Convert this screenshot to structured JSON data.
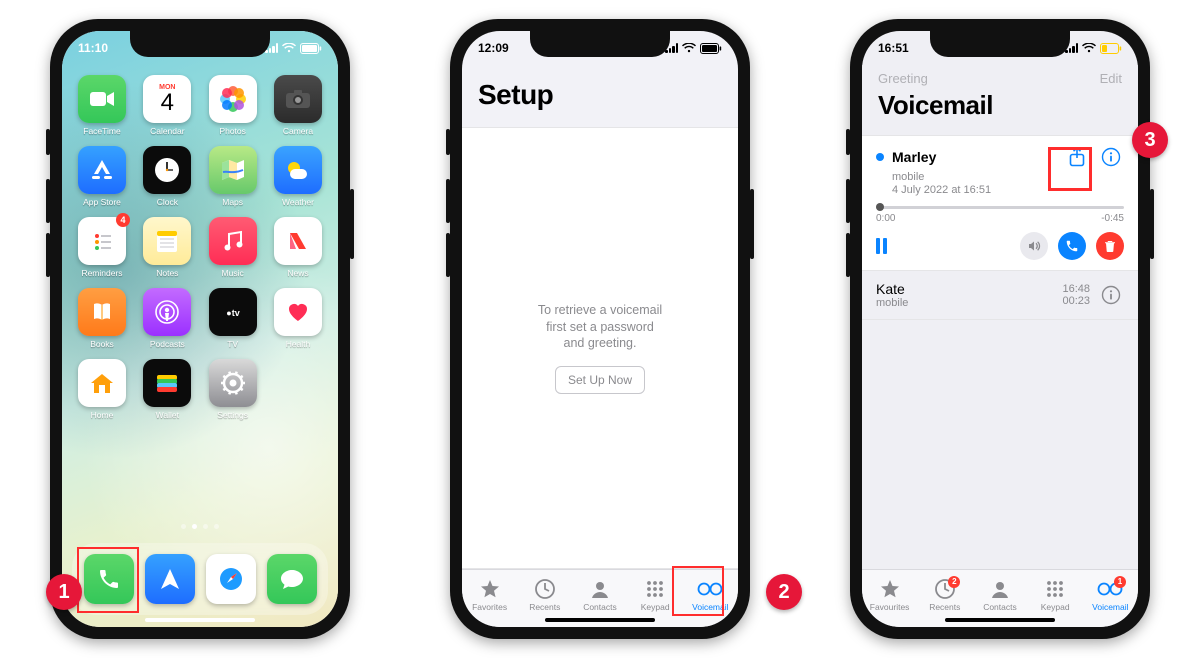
{
  "callouts": [
    "1",
    "2",
    "3"
  ],
  "phone1": {
    "time": "11:10",
    "calendar_day": "MON",
    "calendar_date": "4",
    "apps": {
      "r1": [
        {
          "label": "FaceTime",
          "name": "facetime",
          "bg": "linear-gradient(#5bd769,#34c759)",
          "glyph": "video"
        },
        {
          "label": "Calendar",
          "name": "calendar",
          "bg": "#fff",
          "glyph": "cal"
        },
        {
          "label": "Photos",
          "name": "photos",
          "bg": "#fff",
          "glyph": "photos"
        },
        {
          "label": "Camera",
          "name": "camera",
          "bg": "linear-gradient(#4a4a4a,#2b2b2b)",
          "glyph": "camera"
        }
      ],
      "r2": [
        {
          "label": "App Store",
          "name": "appstore",
          "bg": "linear-gradient(#35a1ff,#1e6dff)",
          "glyph": "appstore"
        },
        {
          "label": "Clock",
          "name": "clock",
          "bg": "#0b0b0b",
          "glyph": "clock"
        },
        {
          "label": "Maps",
          "name": "maps",
          "bg": "linear-gradient(#b8e986,#67c96b)",
          "glyph": "maps"
        },
        {
          "label": "Weather",
          "name": "weather",
          "bg": "linear-gradient(#3aa3ff,#1e6dff)",
          "glyph": "weather"
        }
      ],
      "r3": [
        {
          "label": "Reminders",
          "name": "reminders",
          "bg": "#fff",
          "glyph": "reminders",
          "badge": "4"
        },
        {
          "label": "Notes",
          "name": "notes",
          "bg": "linear-gradient(#fff7cc,#ffeb99)",
          "glyph": "notes"
        },
        {
          "label": "Music",
          "name": "music",
          "bg": "linear-gradient(#ff5b73,#ff2d55)",
          "glyph": "music"
        },
        {
          "label": "News",
          "name": "news",
          "bg": "#fff",
          "glyph": "news"
        }
      ],
      "r4": [
        {
          "label": "Books",
          "name": "books",
          "bg": "linear-gradient(#ff9e42,#ff7a1a)",
          "glyph": "books"
        },
        {
          "label": "Podcasts",
          "name": "podcasts",
          "bg": "linear-gradient(#c36bff,#9b30ff)",
          "glyph": "podcasts"
        },
        {
          "label": "TV",
          "name": "tv",
          "bg": "#0b0b0b",
          "glyph": "tv"
        },
        {
          "label": "Health",
          "name": "health",
          "bg": "#fff",
          "glyph": "health"
        }
      ],
      "r5": [
        {
          "label": "Home",
          "name": "home",
          "bg": "#fff",
          "glyph": "home"
        },
        {
          "label": "Wallet",
          "name": "wallet",
          "bg": "#0b0b0b",
          "glyph": "wallet"
        },
        {
          "label": "Settings",
          "name": "settings",
          "bg": "linear-gradient(#d9d9d9,#8e8e93)",
          "glyph": "gear"
        }
      ]
    },
    "dock": [
      {
        "name": "phone",
        "bg": "linear-gradient(#5bd769,#34c759)",
        "glyph": "phone"
      },
      {
        "name": "arrow",
        "bg": "linear-gradient(#35a1ff,#1e6dff)",
        "glyph": "nav"
      },
      {
        "name": "safari",
        "bg": "#fff",
        "glyph": "safari"
      },
      {
        "name": "messages",
        "bg": "linear-gradient(#5bd769,#34c759)",
        "glyph": "msg"
      }
    ]
  },
  "phone2": {
    "time": "12:09",
    "title": "Setup",
    "body_line1": "To retrieve a voicemail",
    "body_line2": "first set a password",
    "body_line3": "and greeting.",
    "button": "Set Up Now",
    "tabs": [
      {
        "name": "favorites",
        "label": "Favorites"
      },
      {
        "name": "recents",
        "label": "Recents"
      },
      {
        "name": "contacts",
        "label": "Contacts"
      },
      {
        "name": "keypad",
        "label": "Keypad"
      },
      {
        "name": "voicemail",
        "label": "Voicemail",
        "active": true
      }
    ]
  },
  "phone3": {
    "time": "16:51",
    "nav_left": "Greeting",
    "nav_right": "Edit",
    "title": "Voicemail",
    "open": {
      "name": "Marley",
      "type": "mobile",
      "date": "4 July 2022 at 16:51",
      "elapsed": "0:00",
      "remain": "-0:45"
    },
    "second": {
      "name": "Kate",
      "type": "mobile",
      "time": "16:48",
      "dur": "00:23"
    },
    "tabs": [
      {
        "name": "favourites",
        "label": "Favourites"
      },
      {
        "name": "recents",
        "label": "Recents",
        "badge": "2"
      },
      {
        "name": "contacts",
        "label": "Contacts"
      },
      {
        "name": "keypad",
        "label": "Keypad"
      },
      {
        "name": "voicemail",
        "label": "Voicemail",
        "active": true,
        "badge": "1"
      }
    ]
  }
}
